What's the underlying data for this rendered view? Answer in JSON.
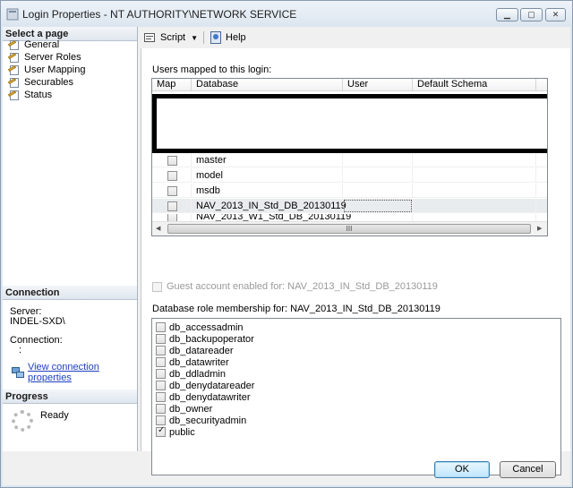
{
  "window": {
    "title": "Login Properties - NT AUTHORITY\\NETWORK SERVICE"
  },
  "left": {
    "select_page_header": "Select a page",
    "pages": [
      {
        "label": "General"
      },
      {
        "label": "Server Roles"
      },
      {
        "label": "User Mapping"
      },
      {
        "label": "Securables"
      },
      {
        "label": "Status"
      }
    ],
    "connection_header": "Connection",
    "server_label": "Server:",
    "server_value": "INDEL-SXD\\",
    "connection_label": "Connection:",
    "connection_value": ":",
    "view_link": "View connection properties",
    "progress_header": "Progress",
    "progress_status": "Ready"
  },
  "toolbar": {
    "script_label": "Script",
    "help_label": "Help"
  },
  "mapping": {
    "label": "Users mapped to this login:",
    "columns": [
      "Map",
      "Database",
      "User",
      "Default Schema"
    ],
    "rows": [
      {
        "database": "master",
        "user": "",
        "schema": ""
      },
      {
        "database": "model",
        "user": "",
        "schema": ""
      },
      {
        "database": "msdb",
        "user": "",
        "schema": ""
      },
      {
        "database": "NAV_2013_IN_Std_DB_20130119",
        "user": "",
        "schema": ""
      },
      {
        "database": "NAV_2013_W1_Std_DB_20130119",
        "user": "",
        "schema": ""
      }
    ],
    "hscroll_grip": "III"
  },
  "guest": {
    "label": "Guest account enabled for: NAV_2013_IN_Std_DB_20130119"
  },
  "roles": {
    "label": "Database role membership for: NAV_2013_IN_Std_DB_20130119",
    "items": [
      {
        "name": "db_accessadmin",
        "checked": false
      },
      {
        "name": "db_backupoperator",
        "checked": false
      },
      {
        "name": "db_datareader",
        "checked": false
      },
      {
        "name": "db_datawriter",
        "checked": false
      },
      {
        "name": "db_ddladmin",
        "checked": false
      },
      {
        "name": "db_denydatareader",
        "checked": false
      },
      {
        "name": "db_denydatawriter",
        "checked": false
      },
      {
        "name": "db_owner",
        "checked": false
      },
      {
        "name": "db_securityadmin",
        "checked": false
      },
      {
        "name": "public",
        "checked": true
      }
    ]
  },
  "buttons": {
    "ok": "OK",
    "cancel": "Cancel"
  }
}
